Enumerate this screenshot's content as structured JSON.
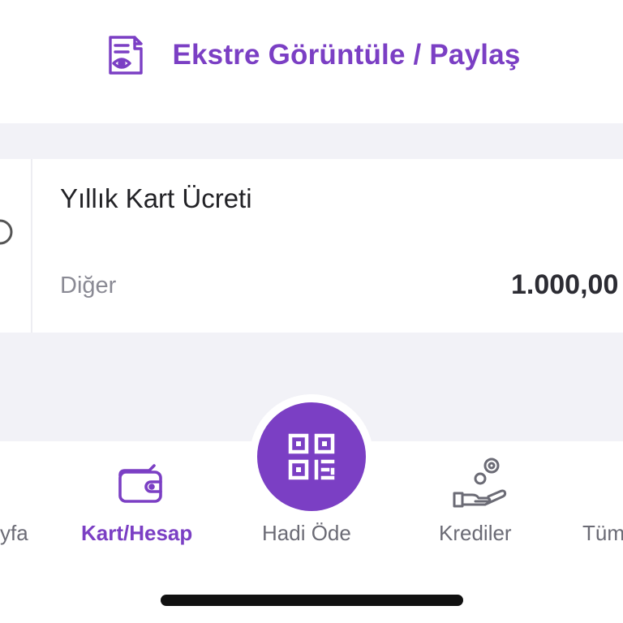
{
  "top_action": {
    "label": "Ekstre Görüntüle / Paylaş",
    "icon": "document-eye-icon"
  },
  "transaction": {
    "title": "Yıllık Kart Ücreti",
    "category": "Diğer",
    "amount": "1.000,00",
    "left_icon": "category-icon"
  },
  "tabbar": {
    "tabs": [
      {
        "label": "Ana Sayfa",
        "visible_label": "yfa",
        "icon": "home-icon",
        "active": false
      },
      {
        "label": "Kart/Hesap",
        "icon": "wallet-icon",
        "active": true
      },
      {
        "label": "Hadi Öde",
        "icon": "qr-code-icon",
        "active": false
      },
      {
        "label": "Krediler",
        "icon": "hand-coins-icon",
        "active": false
      },
      {
        "label": "Tümü",
        "visible_label": "Tüm",
        "icon": "menu-icon",
        "active": false
      }
    ]
  },
  "colors": {
    "accent": "#7B3FC4",
    "background_band": "#F2F2F7",
    "text_primary": "#222226",
    "text_secondary": "#8A8A94"
  }
}
